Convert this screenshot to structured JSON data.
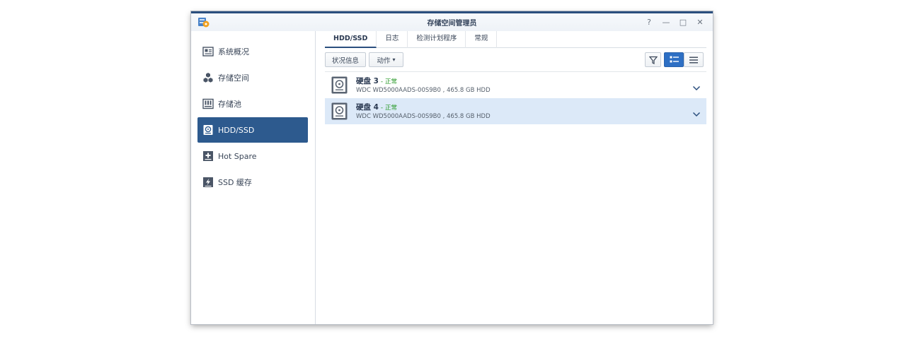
{
  "window": {
    "title": "存储空间管理员",
    "controls": [
      "?",
      "—",
      "□",
      "✕"
    ]
  },
  "sidebar": {
    "items": [
      {
        "label": "系统概况",
        "icon": "overview-icon",
        "active": false
      },
      {
        "label": "存储空间",
        "icon": "cubes-icon",
        "active": false
      },
      {
        "label": "存储池",
        "icon": "pool-icon",
        "active": false
      },
      {
        "label": "HDD/SSD",
        "icon": "hdd-icon",
        "active": true
      },
      {
        "label": "Hot Spare",
        "icon": "hot-spare-icon",
        "active": false
      },
      {
        "label": "SSD 缓存",
        "icon": "ssd-cache-icon",
        "active": false
      }
    ]
  },
  "tabs": [
    {
      "label": "HDD/SSD",
      "active": true
    },
    {
      "label": "日志",
      "active": false
    },
    {
      "label": "检测计划程序",
      "active": false
    },
    {
      "label": "常规",
      "active": false
    }
  ],
  "toolbar": {
    "status_label": "状况信息",
    "action_label": "动作",
    "action_caret": "▾"
  },
  "disks": [
    {
      "name": "硬盘 3",
      "sep": " - ",
      "status": "正常",
      "desc": "WDC WD5000AADS-00S9B0 , 465.8 GB HDD",
      "selected": false
    },
    {
      "name": "硬盘 4",
      "sep": " - ",
      "status": "正常",
      "desc": "WDC WD5000AADS-00S9B0 , 465.8 GB HDD",
      "selected": true
    }
  ],
  "colors": {
    "accent": "#2d5a8e",
    "status_ok": "#2a9a2a",
    "selected_row": "#dce9f8"
  }
}
